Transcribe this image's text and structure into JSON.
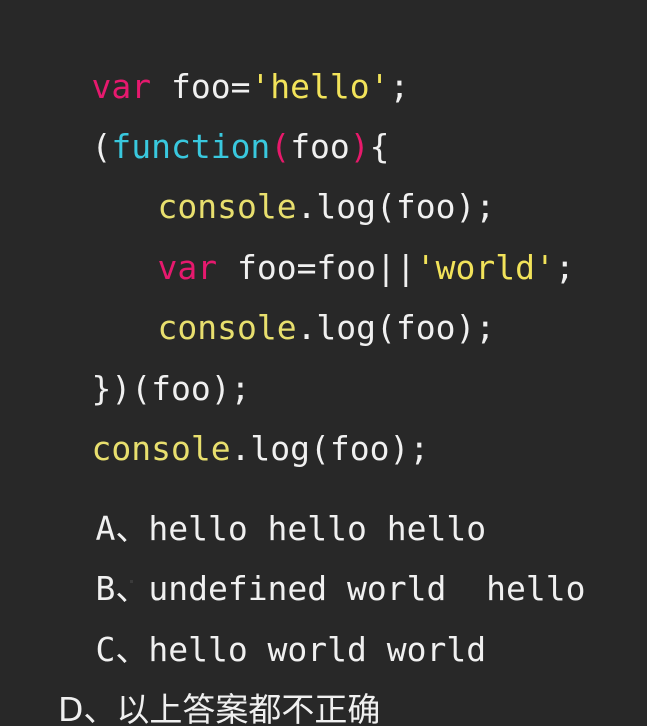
{
  "code": {
    "l1": {
      "kw": "var",
      "rest": " foo=",
      "str": "'hello'",
      "end": ";"
    },
    "l2": {
      "open": "(",
      "fn": "function",
      "p_open": "(",
      "arg": "foo",
      "p_close": ")",
      "brace": "{"
    },
    "l3": {
      "obj": "console",
      "rest": ".log(foo);"
    },
    "l4": {
      "kw": "var",
      "rest": " foo=foo||",
      "str": "'world'",
      "end": ";"
    },
    "l5": {
      "obj": "console",
      "rest": ".log(foo);"
    },
    "l6": {
      "text": "})(foo);"
    },
    "l7": {
      "obj": "console",
      "rest": ".log(foo);"
    }
  },
  "options": [
    {
      "label": "A、hello hello hello"
    },
    {
      "label": "B、undefined world  hello"
    },
    {
      "label": "C、hello world world"
    },
    {
      "label": "D、以上答案都不正确"
    }
  ],
  "colors": {
    "background": "#282828",
    "keyword": "#e6196e",
    "function": "#39c8de",
    "string": "#f2e35a",
    "text": "#f0f0f0"
  }
}
